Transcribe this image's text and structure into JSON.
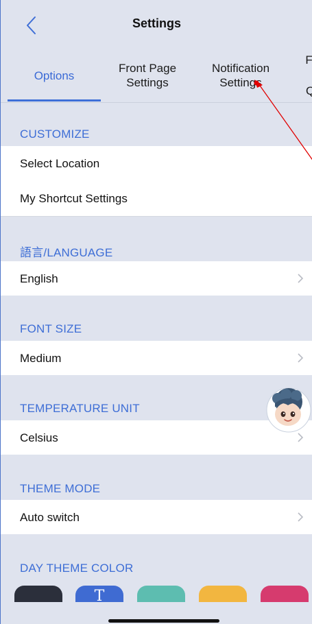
{
  "header": {
    "title": "Settings"
  },
  "tabs": [
    {
      "line1": "Options",
      "line2": ""
    },
    {
      "line1": "Front Page",
      "line2": "Settings"
    },
    {
      "line1": "Notification",
      "line2": "Settings"
    },
    {
      "line1": "F",
      "line2": "Q"
    }
  ],
  "sections": {
    "customize": {
      "title": "CUSTOMIZE",
      "items": [
        "Select Location",
        "My Shortcut Settings"
      ]
    },
    "language": {
      "title": "語言/LANGUAGE",
      "value": "English"
    },
    "font_size": {
      "title": "FONT SIZE",
      "value": "Medium"
    },
    "temperature": {
      "title": "TEMPERATURE UNIT",
      "value": "Celsius"
    },
    "theme_mode": {
      "title": "THEME MODE",
      "value": "Auto switch"
    },
    "day_theme": {
      "title": "DAY THEME COLOR",
      "swatches": [
        {
          "color": "#2b2f3b",
          "label": ""
        },
        {
          "color": "#3f6bd2",
          "label": "T"
        },
        {
          "color": "#5dbdb0",
          "label": ""
        },
        {
          "color": "#f2b640",
          "label": ""
        },
        {
          "color": "#d63b6e",
          "label": ""
        }
      ]
    }
  },
  "colors": {
    "accent": "#3e6ed6",
    "background": "#dfe3ee",
    "annotation": "#e00000"
  }
}
